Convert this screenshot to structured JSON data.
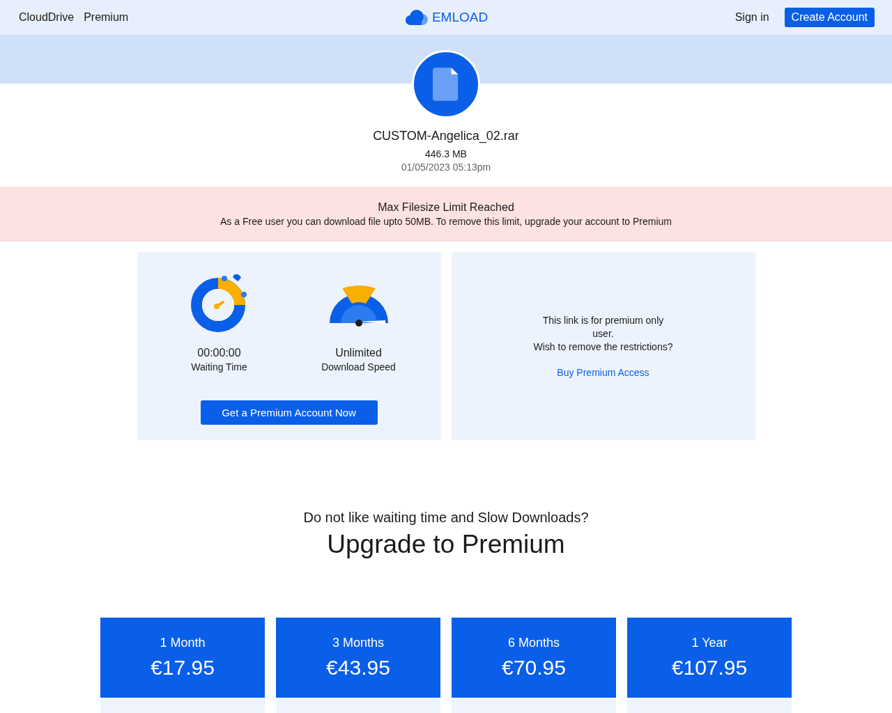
{
  "nav": {
    "left_links": [
      "CloudDrive",
      "Premium"
    ],
    "brand": "EMLOAD",
    "sign_in": "Sign in",
    "create_account": "Create Account"
  },
  "file": {
    "name": "CUSTOM-Angelica_02.rar",
    "size": "446.3 MB",
    "date": "01/05/2023 05:13pm"
  },
  "alert": {
    "title": "Max Filesize Limit Reached",
    "message": "As a Free user you can download file upto 50MB. To remove this limit, upgrade your account to Premium"
  },
  "stats": [
    {
      "kind": "timer",
      "value": "00:00:00",
      "label": "Waiting Time"
    },
    {
      "kind": "speed",
      "value": "Unlimited",
      "label": "Download Speed"
    }
  ],
  "premium_button": "Get a Premium Account Now",
  "premium_note": {
    "lines": [
      "This link is for premium only user.",
      "Wish to remove the restrictions?"
    ],
    "link": "Buy Premium Access"
  },
  "upgrade": {
    "question": "Do not like waiting time and Slow Downloads?",
    "heading": "Upgrade to Premium"
  },
  "plans": [
    {
      "period": "1 Month",
      "price": "€17.95"
    },
    {
      "period": "3 Months",
      "price": "€43.95"
    },
    {
      "period": "6 Months",
      "price": "€70.95"
    },
    {
      "period": "1 Year",
      "price": "€107.95"
    }
  ]
}
